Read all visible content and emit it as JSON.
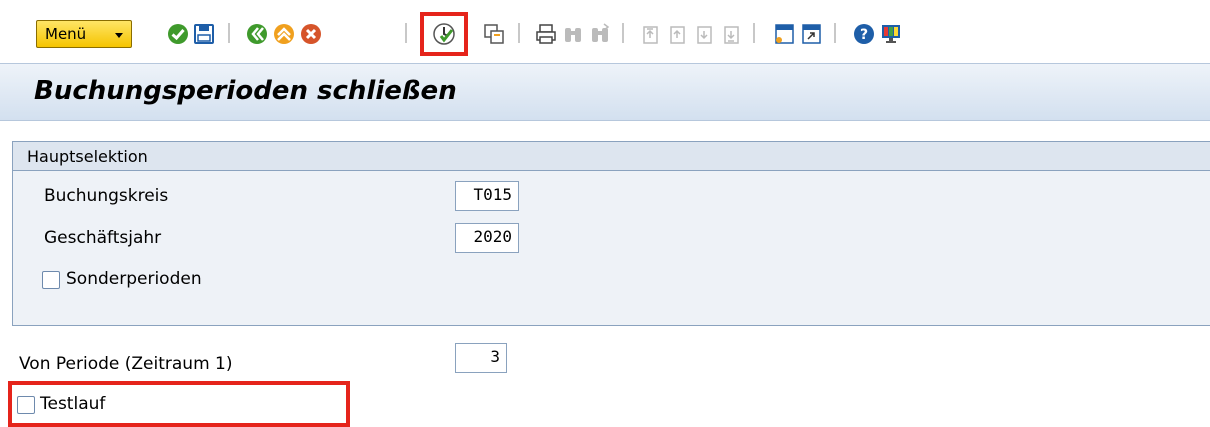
{
  "toolbar": {
    "menu_label": "Menü",
    "icons": [
      "enter-icon",
      "save-icon",
      "back-icon",
      "exit-icon",
      "cancel-icon",
      "execute-icon",
      "selection-options-icon",
      "print-icon",
      "find-icon",
      "find-next-icon",
      "first-page-icon",
      "previous-page-icon",
      "next-page-icon",
      "last-page-icon",
      "create-session-icon",
      "shortcut-icon",
      "help-icon",
      "customize-layout-icon"
    ],
    "highlight_color": "#e5241b"
  },
  "title": "Buchungsperioden schließen",
  "main_selection": {
    "group_title": "Hauptselektion",
    "company_code_label": "Buchungskreis",
    "company_code_value": "T015",
    "fiscal_year_label": "Geschäftsjahr",
    "fiscal_year_value": "2020",
    "special_periods_label": "Sonderperioden",
    "special_periods_checked": false
  },
  "from_period_label": "Von Periode (Zeitraum 1)",
  "from_period_value": "3",
  "test_run_label": "Testlauf",
  "test_run_checked": false
}
